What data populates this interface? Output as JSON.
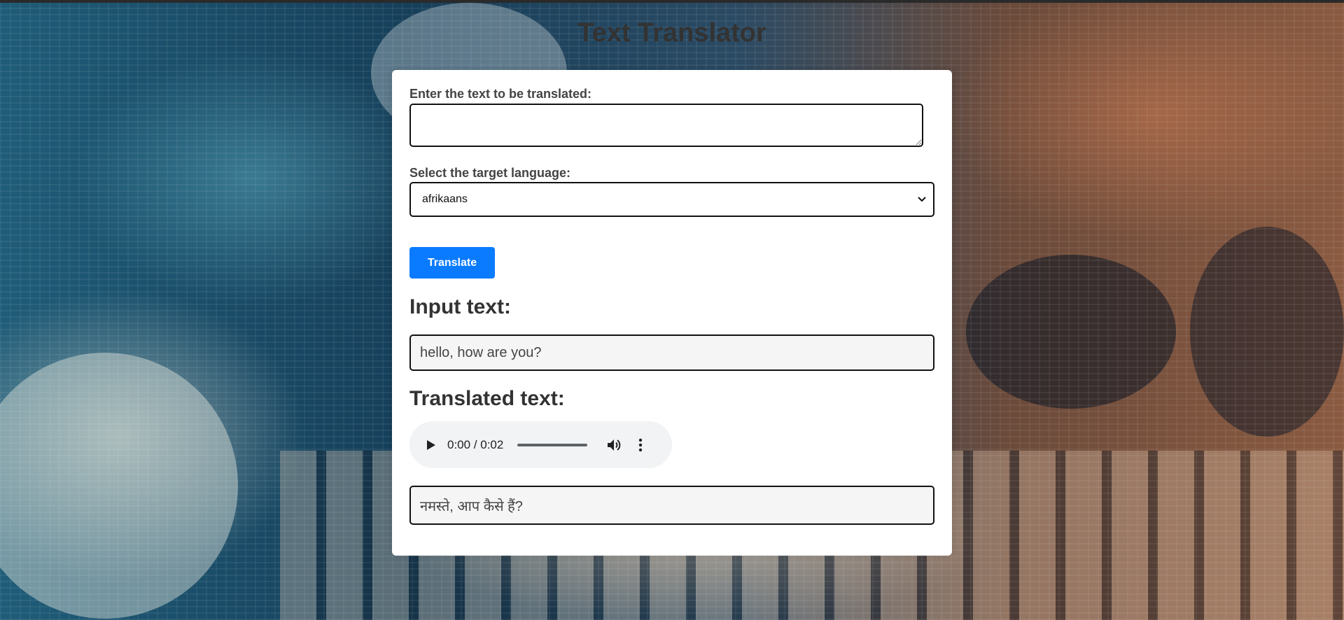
{
  "page": {
    "title": "Text Translator"
  },
  "form": {
    "text_label": "Enter the text to be translated:",
    "text_value": "",
    "language_label": "Select the target language:",
    "language_selected": "afrikaans",
    "translate_button": "Translate"
  },
  "results": {
    "input_heading": "Input text:",
    "input_value": "hello, how are you?",
    "translated_heading": "Translated text:",
    "audio": {
      "current_time": "0:00",
      "duration": "0:02",
      "time_display": "0:00 / 0:02",
      "progress": 0
    },
    "translated_value": "नमस्ते, आप कैसे हैं?"
  },
  "colors": {
    "accent": "#0a7bff",
    "title": "#333333",
    "card": "#ffffff"
  },
  "icons": {
    "play": "play-icon",
    "volume": "volume-icon",
    "more": "more-vertical-icon",
    "dropdown": "chevron-down-icon"
  }
}
